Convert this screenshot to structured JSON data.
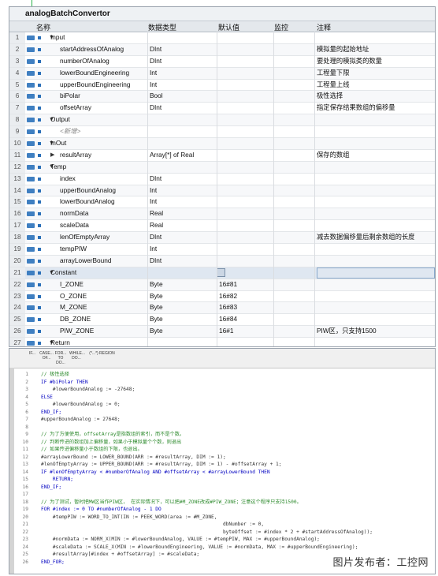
{
  "block_title": "analogBatchConvertor",
  "columns": {
    "name": "名称",
    "type": "数据类型",
    "default": "默认值",
    "monitor": "监控",
    "comment": "注释"
  },
  "rows": [
    {
      "n": "1",
      "name": "Input",
      "type": "",
      "def": "",
      "cmt": "",
      "lvl": 0,
      "sec": true
    },
    {
      "n": "2",
      "name": "startAddressOfAnalog",
      "type": "DInt",
      "def": "",
      "cmt": "模拟量的起始地址",
      "lvl": 1
    },
    {
      "n": "3",
      "name": "numberOfAnalog",
      "type": "DInt",
      "def": "",
      "cmt": "要处理的模拟类的数量",
      "lvl": 1
    },
    {
      "n": "4",
      "name": "lowerBoundEngineering",
      "type": "Int",
      "def": "",
      "cmt": "工程量下限",
      "lvl": 1
    },
    {
      "n": "5",
      "name": "upperBoundEngineering",
      "type": "Int",
      "def": "",
      "cmt": "工程量上线",
      "lvl": 1
    },
    {
      "n": "6",
      "name": "biPolar",
      "type": "Bool",
      "def": "",
      "cmt": "极性选择",
      "lvl": 1
    },
    {
      "n": "7",
      "name": "offsetArray",
      "type": "DInt",
      "def": "",
      "cmt": "指定保存结果数组的偏移量",
      "lvl": 1
    },
    {
      "n": "8",
      "name": "Output",
      "type": "",
      "def": "",
      "cmt": "",
      "lvl": 0,
      "sec": true
    },
    {
      "n": "9",
      "name": "<新增>",
      "type": "",
      "def": "",
      "cmt": "",
      "lvl": 1,
      "grey": true
    },
    {
      "n": "10",
      "name": "InOut",
      "type": "",
      "def": "",
      "cmt": "",
      "lvl": 0,
      "sec": true
    },
    {
      "n": "11",
      "name": "resultArray",
      "type": "Array[*] of Real",
      "def": "",
      "cmt": "保存的数组",
      "lvl": 1,
      "arr": true
    },
    {
      "n": "12",
      "name": "Temp",
      "type": "",
      "def": "",
      "cmt": "",
      "lvl": 0,
      "sec": true
    },
    {
      "n": "13",
      "name": "index",
      "type": "DInt",
      "def": "",
      "cmt": "",
      "lvl": 1
    },
    {
      "n": "14",
      "name": "upperBoundAnalog",
      "type": "Int",
      "def": "",
      "cmt": "",
      "lvl": 1
    },
    {
      "n": "15",
      "name": "lowerBoundAnalog",
      "type": "Int",
      "def": "",
      "cmt": "",
      "lvl": 1
    },
    {
      "n": "16",
      "name": "normData",
      "type": "Real",
      "def": "",
      "cmt": "",
      "lvl": 1
    },
    {
      "n": "17",
      "name": "scaleData",
      "type": "Real",
      "def": "",
      "cmt": "",
      "lvl": 1
    },
    {
      "n": "18",
      "name": "lenOfEmptyArray",
      "type": "DInt",
      "def": "",
      "cmt": "减去数据偏移量后剩余数组的长度",
      "lvl": 1
    },
    {
      "n": "19",
      "name": "tempPIW",
      "type": "Int",
      "def": "",
      "cmt": "",
      "lvl": 1
    },
    {
      "n": "20",
      "name": "arrayLowerBound",
      "type": "DInt",
      "def": "",
      "cmt": "",
      "lvl": 1
    },
    {
      "n": "21",
      "name": "Constant",
      "type": "",
      "def": "",
      "cmt": "",
      "lvl": 0,
      "sec": true,
      "sel": true
    },
    {
      "n": "22",
      "name": "I_ZONE",
      "type": "Byte",
      "def": "16#81",
      "cmt": "",
      "lvl": 1
    },
    {
      "n": "23",
      "name": "O_ZONE",
      "type": "Byte",
      "def": "16#82",
      "cmt": "",
      "lvl": 1
    },
    {
      "n": "24",
      "name": "M_ZONE",
      "type": "Byte",
      "def": "16#83",
      "cmt": "",
      "lvl": 1
    },
    {
      "n": "25",
      "name": "DB_ZONE",
      "type": "Byte",
      "def": "16#84",
      "cmt": "",
      "lvl": 1
    },
    {
      "n": "26",
      "name": "PIW_ZONE",
      "type": "Byte",
      "def": "16#1",
      "cmt": "PIW区，只支持1500",
      "lvl": 1
    },
    {
      "n": "27",
      "name": "Return",
      "type": "",
      "def": "",
      "cmt": "",
      "lvl": 0,
      "sec": true
    },
    {
      "n": "28",
      "name": "analogBatchConvertor",
      "type": "Void",
      "def": "",
      "cmt": "",
      "lvl": 1
    }
  ],
  "toolbar": [
    "IF...",
    "CASE... OF...",
    "FOR... TO DO...",
    "WHILE... DO...",
    "(*...*)",
    "REGION"
  ],
  "code": [
    {
      "n": "1",
      "t": "// 极性选择",
      "k": "cm"
    },
    {
      "n": "2",
      "t": "IF #biPolar THEN",
      "k": "kw"
    },
    {
      "n": "3",
      "t": "    #lowerBoundAnalog := -27648;",
      "k": "vr"
    },
    {
      "n": "4",
      "t": "ELSE",
      "k": "kw"
    },
    {
      "n": "5",
      "t": "    #lowerBoundAnalog := 0;",
      "k": "vr"
    },
    {
      "n": "6",
      "t": "END_IF;",
      "k": "kw"
    },
    {
      "n": "7",
      "t": "#upperBoundAnalog := 27648;",
      "k": "vr"
    },
    {
      "n": "8",
      "t": "",
      "k": "vr"
    },
    {
      "n": "9",
      "t": "// 为了方便使用，offsetArray是指数组的索引，而不是个数。",
      "k": "cm"
    },
    {
      "n": "10",
      "t": "// 判断传进的数组加上偏移量，如果小于模拟量个个数，则退出",
      "k": "cm"
    },
    {
      "n": "11",
      "t": "// 如果传进偏移量小于数组的下限，也退出。",
      "k": "cm"
    },
    {
      "n": "12",
      "t": "#arrayLowerBound := LOWER_BOUND(ARR := #resultArray, DIM := 1);",
      "k": "vr"
    },
    {
      "n": "13",
      "t": "#lenOfEmptyArray := UPPER_BOUND(ARR := #resultArray, DIM := 1) - #offsetArray + 1;",
      "k": "vr"
    },
    {
      "n": "14",
      "t": "IF #lenOfEmptyArray < #numberOfAnalog AND #offsetArray < #arrayLowerBound THEN",
      "k": "kw"
    },
    {
      "n": "15",
      "t": "    RETURN;",
      "k": "kw"
    },
    {
      "n": "16",
      "t": "END_IF;",
      "k": "kw"
    },
    {
      "n": "17",
      "t": "",
      "k": "vr"
    },
    {
      "n": "18",
      "t": "// 为了测试，暂时把MW区当作PIW区， 在实际情况下，可以把#M_ZONE改成#PIW_ZONE；注意这个程序只支持1500。",
      "k": "cm"
    },
    {
      "n": "19",
      "t": "FOR #index := 0 TO #numberOfAnalog - 1 DO",
      "k": "kw"
    },
    {
      "n": "20",
      "t": "    #tempPIW := WORD_TO_INT(IN := PEEK_WORD(area := #M_ZONE,",
      "k": "vr"
    },
    {
      "n": "21",
      "t": "                                                              dbNumber := 0,",
      "k": "vr"
    },
    {
      "n": "22",
      "t": "                                                              byteOffset := #index * 2 + #startAddressOfAnalog));",
      "k": "vr"
    },
    {
      "n": "23",
      "t": "    #normData := NORM_X(MIN := #lowerBoundAnalog, VALUE := #tempPIW, MAX := #upperBoundAnalog);",
      "k": "vr"
    },
    {
      "n": "24",
      "t": "    #scaleData := SCALE_X(MIN := #lowerBoundEngineering, VALUE := #normData, MAX := #upperBoundEngineering);",
      "k": "vr"
    },
    {
      "n": "25",
      "t": "    #resultArray[#index + #offsetArray] := #scaleData;",
      "k": "vr"
    },
    {
      "n": "26",
      "t": "END_FOR;",
      "k": "kw"
    }
  ],
  "watermark": "图片发布者：工控网"
}
